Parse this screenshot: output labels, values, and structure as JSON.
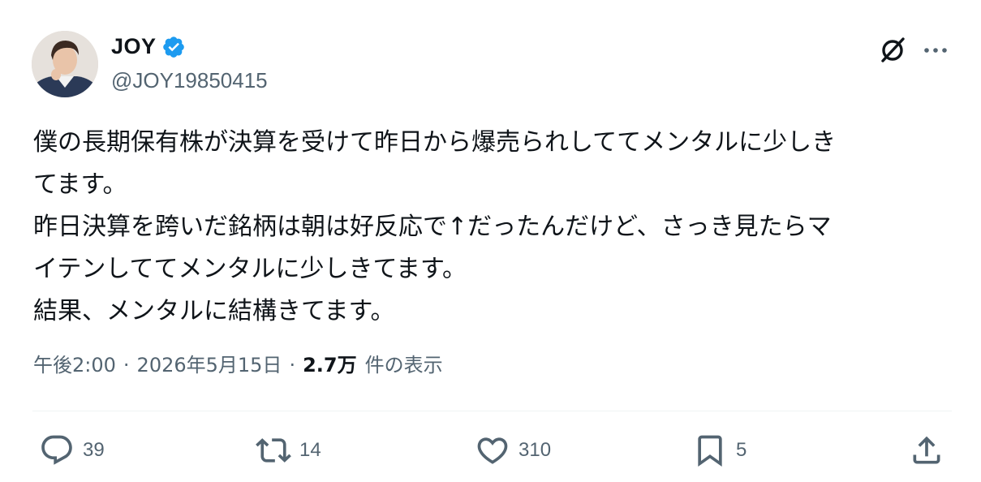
{
  "author": {
    "display_name": "JOY",
    "handle": "@JOY19850415",
    "verified": true
  },
  "tweet": {
    "lines": [
      "僕の長期保有株が決算を受けて昨日から爆売られしててメンタルに少しき",
      "てます。",
      "昨日決算を跨いだ銘柄は朝は好反応で↑だったんだけど、さっき見たらマ",
      "イテンしててメンタルに少しきてます。",
      "結果、メンタルに結構きてます。"
    ]
  },
  "meta": {
    "time": "午後2:00",
    "separator": "·",
    "date": "2026年5月15日",
    "views_count": "2.7万",
    "views_label": "件の表示"
  },
  "actions": {
    "replies": "39",
    "reposts": "14",
    "likes": "310",
    "bookmarks": "5"
  },
  "icons": {
    "header": [
      "verified-badge-icon",
      "grok-icon",
      "more-icon"
    ],
    "actions": [
      "reply-icon",
      "retweet-icon",
      "like-icon",
      "bookmark-icon",
      "share-icon"
    ]
  },
  "colors": {
    "verified": "#1d9bf0",
    "text_primary": "#0f1419",
    "text_secondary": "#536471",
    "divider": "#eff3f4"
  }
}
